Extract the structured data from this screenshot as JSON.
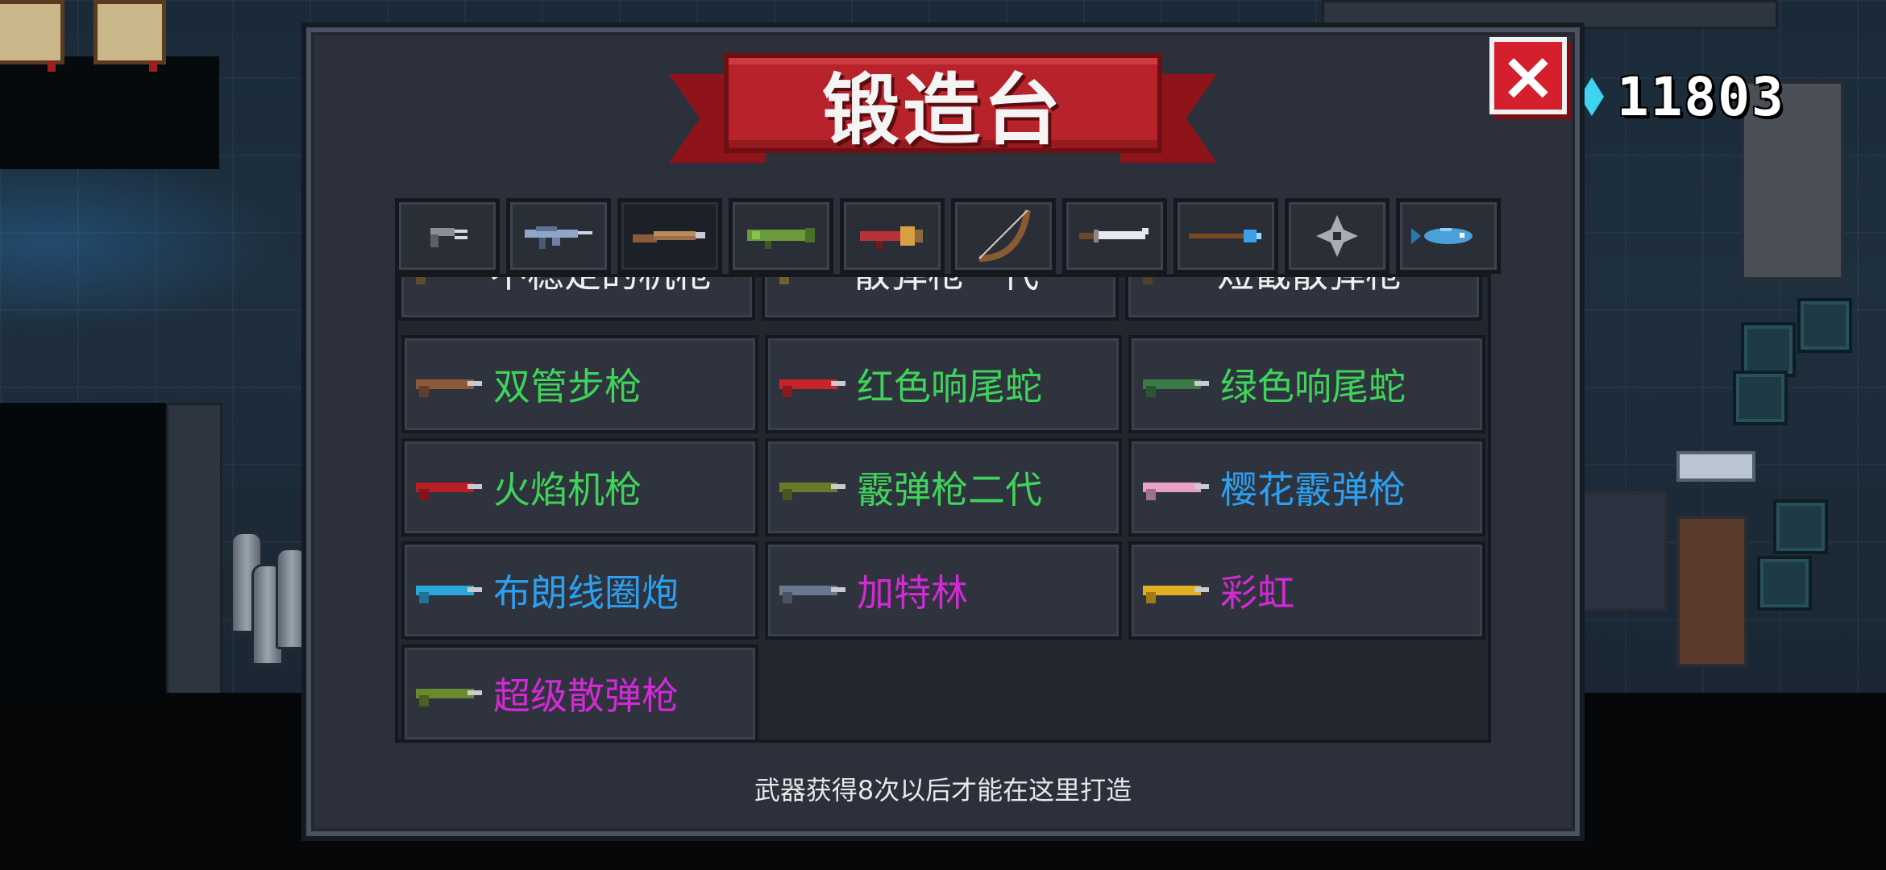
{
  "title": "锻造台",
  "currency": {
    "value": "11803",
    "icon": "gem-icon",
    "color": "#3fd3f2"
  },
  "close_label": "×",
  "tabs": [
    {
      "icon": "pistol-icon"
    },
    {
      "icon": "rifle-icon"
    },
    {
      "icon": "shotgun-icon",
      "active": true
    },
    {
      "icon": "rocket-launcher-icon"
    },
    {
      "icon": "cannon-icon"
    },
    {
      "icon": "bow-icon"
    },
    {
      "icon": "sword-icon"
    },
    {
      "icon": "staff-icon"
    },
    {
      "icon": "shuriken-icon"
    },
    {
      "icon": "fish-icon"
    }
  ],
  "partial_row": [
    "不稳定的机枪",
    "散弹枪一代",
    "短截散弹枪"
  ],
  "weapons": [
    {
      "name": "双管步枪",
      "rarity": "green",
      "color": "#8a5a3a"
    },
    {
      "name": "红色响尾蛇",
      "rarity": "green",
      "color": "#c8242c"
    },
    {
      "name": "绿色响尾蛇",
      "rarity": "green",
      "color": "#3c7a46"
    },
    {
      "name": "火焰机枪",
      "rarity": "green",
      "color": "#b81e24"
    },
    {
      "name": "霰弹枪二代",
      "rarity": "green",
      "color": "#6b7a2a"
    },
    {
      "name": "樱花霰弹枪",
      "rarity": "blue",
      "color": "#e8a0c8"
    },
    {
      "name": "布朗线圈炮",
      "rarity": "blue",
      "color": "#2aa6d8"
    },
    {
      "name": "加特林",
      "rarity": "purple",
      "color": "#6a7890"
    },
    {
      "name": "彩虹",
      "rarity": "purple",
      "color": "#e0b020"
    },
    {
      "name": "超级散弹枪",
      "rarity": "purple",
      "color": "#6a8a30"
    }
  ],
  "footer": "武器获得8次以后才能在这里打造"
}
